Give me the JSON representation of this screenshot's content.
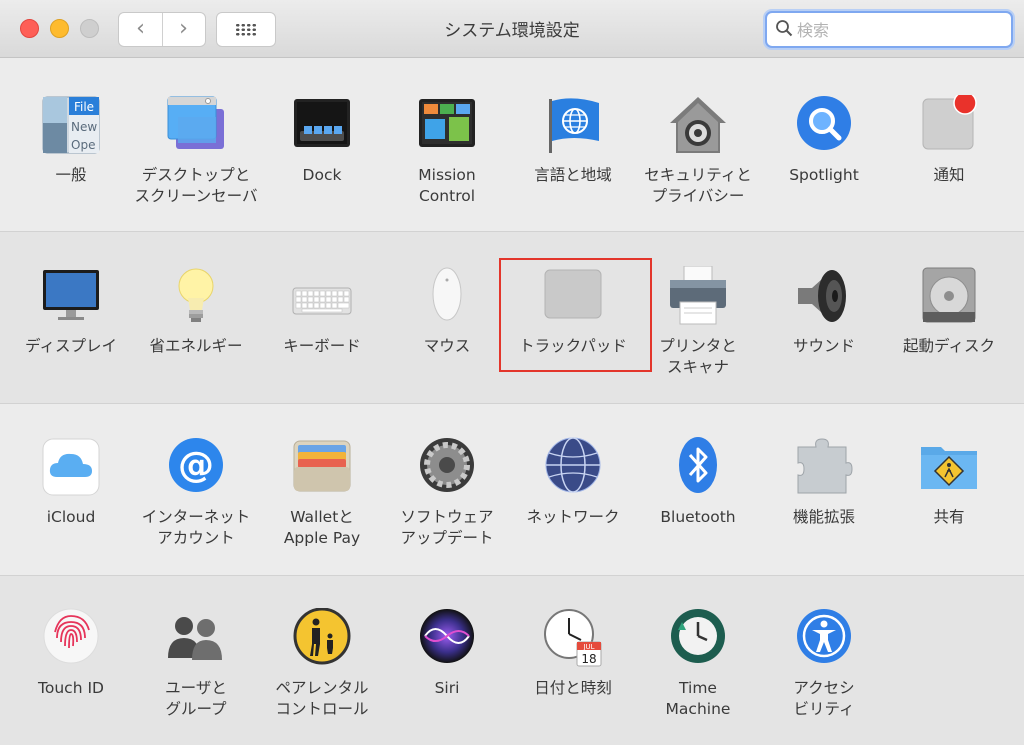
{
  "window": {
    "title": "システム環境設定"
  },
  "toolbar": {
    "back_label": "‹",
    "forward_label": "›"
  },
  "search": {
    "placeholder": "検索"
  },
  "panes": {
    "row1": [
      {
        "label": "一般"
      },
      {
        "label": "デスクトップと\nスクリーンセーバ"
      },
      {
        "label": "Dock"
      },
      {
        "label": "Mission\nControl"
      },
      {
        "label": "言語と地域"
      },
      {
        "label": "セキュリティと\nプライバシー"
      },
      {
        "label": "Spotlight"
      },
      {
        "label": "通知"
      }
    ],
    "row2": [
      {
        "label": "ディスプレイ"
      },
      {
        "label": "省エネルギー"
      },
      {
        "label": "キーボード"
      },
      {
        "label": "マウス"
      },
      {
        "label": "トラックパッド"
      },
      {
        "label": "プリンタと\nスキャナ"
      },
      {
        "label": "サウンド"
      },
      {
        "label": "起動ディスク"
      }
    ],
    "row3": [
      {
        "label": "iCloud"
      },
      {
        "label": "インターネット\nアカウント"
      },
      {
        "label": "Walletと\nApple Pay"
      },
      {
        "label": "ソフトウェア\nアップデート"
      },
      {
        "label": "ネットワーク"
      },
      {
        "label": "Bluetooth"
      },
      {
        "label": "機能拡張"
      },
      {
        "label": "共有"
      }
    ],
    "row4": [
      {
        "label": "Touch ID"
      },
      {
        "label": "ユーザと\nグループ"
      },
      {
        "label": "ペアレンタル\nコントロール"
      },
      {
        "label": "Siri"
      },
      {
        "label": "日付と時刻"
      },
      {
        "label": "Time\nMachine"
      },
      {
        "label": "アクセシ\nビリティ"
      }
    ]
  },
  "icons": {
    "general_text_1": "File",
    "general_text_2": "New",
    "general_text_3": "Ope",
    "calendar_month": "JUL",
    "calendar_day": "18"
  },
  "colors": {
    "selection": "#e3352b",
    "accent": "#2f7ee6"
  }
}
